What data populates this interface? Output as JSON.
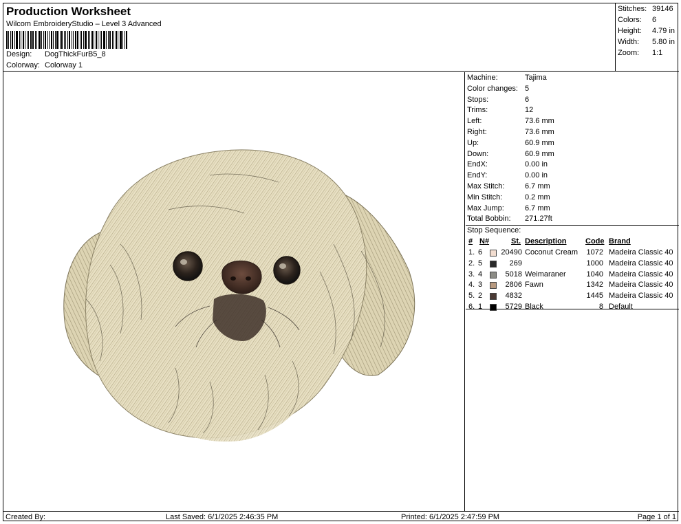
{
  "header": {
    "title": "Production Worksheet",
    "subtitle": "Wilcom EmbroideryStudio – Level 3 Advanced",
    "design_label": "Design:",
    "design_value": "DogThickFurB5_8",
    "colorway_label": "Colorway:",
    "colorway_value": "Colorway 1"
  },
  "summary": {
    "stitches_label": "Stitches:",
    "stitches_value": "39146",
    "colors_label": "Colors:",
    "colors_value": "6",
    "height_label": "Height:",
    "height_value": "4.79 in",
    "width_label": "Width:",
    "width_value": "5.80 in",
    "zoom_label": "Zoom:",
    "zoom_value": "1:1"
  },
  "machine_info": [
    {
      "label": "Machine:",
      "value": "Tajima"
    },
    {
      "label": "Color changes:",
      "value": "5"
    },
    {
      "label": "Stops:",
      "value": "6"
    },
    {
      "label": "Trims:",
      "value": "12"
    },
    {
      "label": "Left:",
      "value": "73.6 mm"
    },
    {
      "label": "Right:",
      "value": "73.6 mm"
    },
    {
      "label": "Up:",
      "value": "60.9 mm"
    },
    {
      "label": "Down:",
      "value": "60.9 mm"
    },
    {
      "label": "EndX:",
      "value": "0.00 in"
    },
    {
      "label": "EndY:",
      "value": "0.00 in"
    },
    {
      "label": "Max Stitch:",
      "value": "6.7 mm"
    },
    {
      "label": "Min Stitch:",
      "value": "0.2 mm"
    },
    {
      "label": "Max Jump:",
      "value": "6.7 mm"
    },
    {
      "label": "Total Bobbin:",
      "value": "271.27ft"
    }
  ],
  "stop_sequence": {
    "title": "Stop Sequence:",
    "headers": {
      "num": "#",
      "n": "N#",
      "st": "St.",
      "desc": "Description",
      "code": "Code",
      "brand": "Brand"
    },
    "rows": [
      {
        "num": "1.",
        "n": "6",
        "color": "#f2ddd0",
        "st": "20490",
        "desc": "Coconut Cream",
        "code": "1072",
        "brand": "Madeira Classic 40"
      },
      {
        "num": "2.",
        "n": "5",
        "color": "#2a2a2a",
        "st": "269",
        "desc": "",
        "code": "1000",
        "brand": "Madeira Classic 40"
      },
      {
        "num": "3.",
        "n": "4",
        "color": "#8c8c86",
        "st": "5018",
        "desc": "Weimaraner",
        "code": "1040",
        "brand": "Madeira Classic 40"
      },
      {
        "num": "4.",
        "n": "3",
        "color": "#b89a80",
        "st": "2806",
        "desc": "Fawn",
        "code": "1342",
        "brand": "Madeira Classic 40"
      },
      {
        "num": "5.",
        "n": "2",
        "color": "#4a3a34",
        "st": "4832",
        "desc": "",
        "code": "1445",
        "brand": "Madeira Classic 40"
      },
      {
        "num": "6.",
        "n": "1",
        "color": "#000000",
        "st": "5729",
        "desc": "Black",
        "code": "8",
        "brand": "Default"
      }
    ]
  },
  "footer": {
    "created_by": "Created By:",
    "last_saved": "Last Saved: 6/1/2025 2:46:35 PM",
    "printed": "Printed: 6/1/2025 2:47:59 PM",
    "page": "Page 1 of 1"
  }
}
